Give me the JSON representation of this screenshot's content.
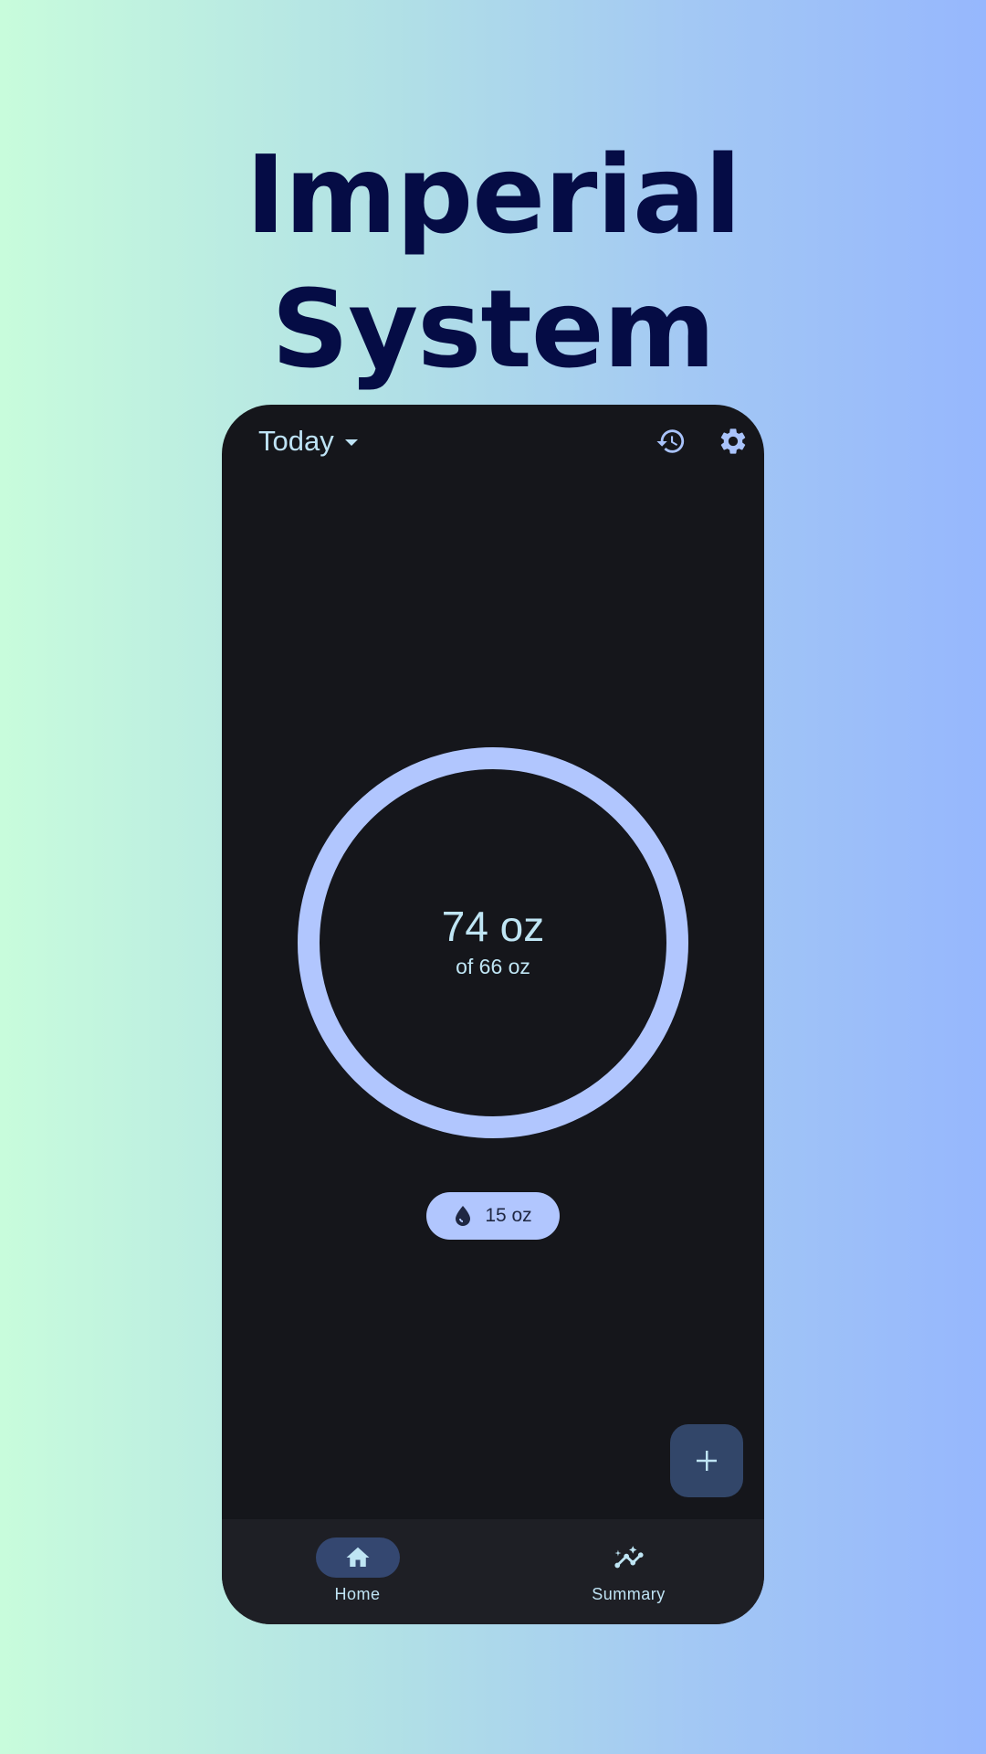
{
  "promo": {
    "title_line1": "Imperial",
    "title_line2": "System"
  },
  "topbar": {
    "date_label": "Today",
    "history_icon": "history-icon",
    "settings_icon": "gear-icon"
  },
  "progress": {
    "intake": "74 oz",
    "goal": "of 66 oz",
    "fill_fraction": 1.0,
    "ring_color": "#b1c6fe"
  },
  "quick_add": {
    "icon": "water-drop-icon",
    "label": "15 oz"
  },
  "fab": {
    "icon": "plus-icon"
  },
  "bottom_nav": {
    "items": [
      {
        "label": "Home",
        "icon": "home-icon",
        "selected": true
      },
      {
        "label": "Summary",
        "icon": "insights-icon",
        "selected": false
      }
    ]
  },
  "colors": {
    "text_primary": "#bfe5f4",
    "accent": "#b1c6fe",
    "surface": "#15161b",
    "nav_surface": "#1e1f25",
    "fab": "#324669",
    "headline": "#050c45"
  }
}
